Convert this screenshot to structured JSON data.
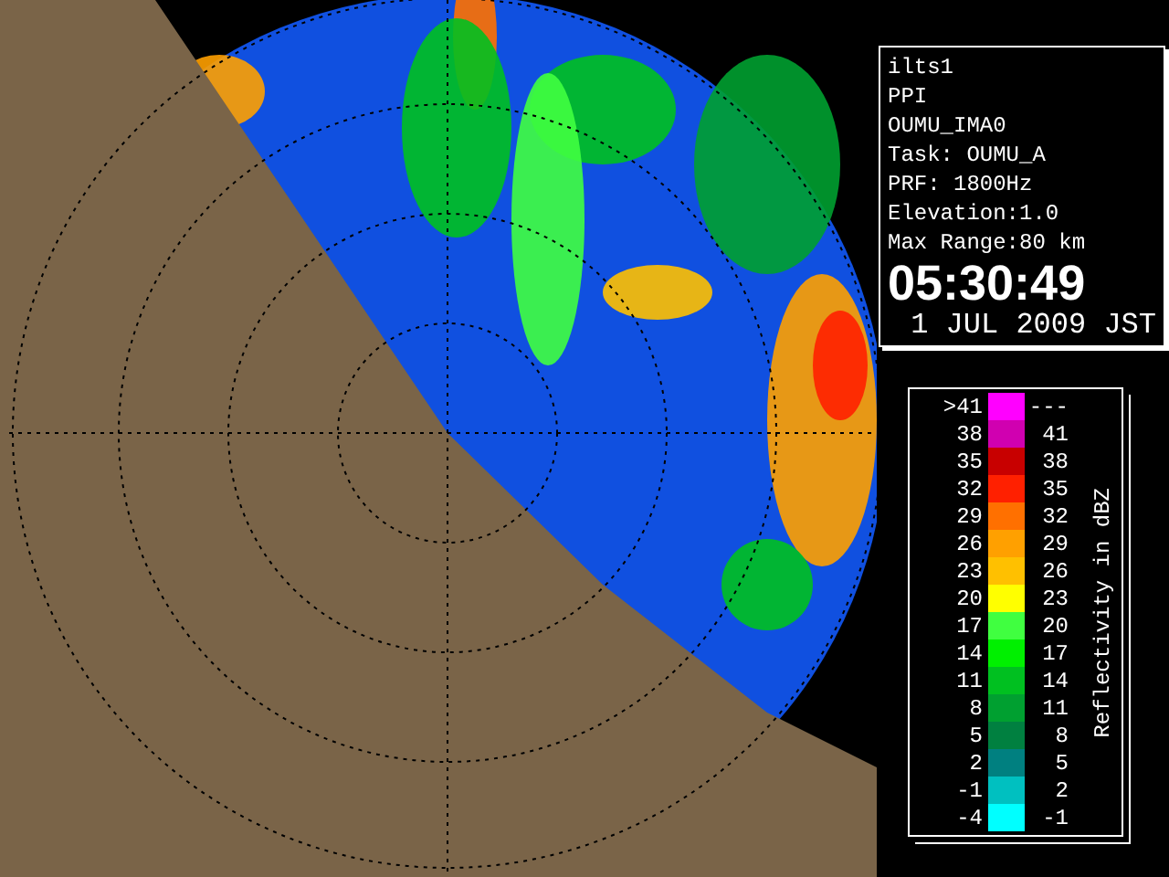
{
  "info_panel": {
    "lines": [
      "ilts1",
      "PPI",
      "OUMU_IMA0",
      "Task: OUMU_A",
      "PRF: 1800Hz",
      "Elevation:1.0",
      "Max Range:80 km"
    ],
    "time": "05:30:49",
    "date": "1 JUL 2009 JST"
  },
  "legend": {
    "title": "Reflectivity in dBZ",
    "rows": [
      {
        "low": ">41",
        "high": "---",
        "color": "#ff00ff"
      },
      {
        "low": "38",
        "high": "41",
        "color": "#d000b0"
      },
      {
        "low": "35",
        "high": "38",
        "color": "#c80000"
      },
      {
        "low": "32",
        "high": "35",
        "color": "#ff2000"
      },
      {
        "low": "29",
        "high": "32",
        "color": "#ff7000"
      },
      {
        "low": "26",
        "high": "29",
        "color": "#ffa000"
      },
      {
        "low": "23",
        "high": "26",
        "color": "#ffc000"
      },
      {
        "low": "20",
        "high": "23",
        "color": "#ffff00"
      },
      {
        "low": "17",
        "high": "20",
        "color": "#40ff40"
      },
      {
        "low": "14",
        "high": "17",
        "color": "#00f000"
      },
      {
        "low": "11",
        "high": "14",
        "color": "#00c020"
      },
      {
        "low": "8",
        "high": "11",
        "color": "#00a030"
      },
      {
        "low": "5",
        "high": "8",
        "color": "#008040"
      },
      {
        "low": "2",
        "high": "5",
        "color": "#008080"
      },
      {
        "low": "-1",
        "high": "2",
        "color": "#00c0c0"
      },
      {
        "low": "-4",
        "high": "-1",
        "color": "#00ffff"
      }
    ]
  }
}
